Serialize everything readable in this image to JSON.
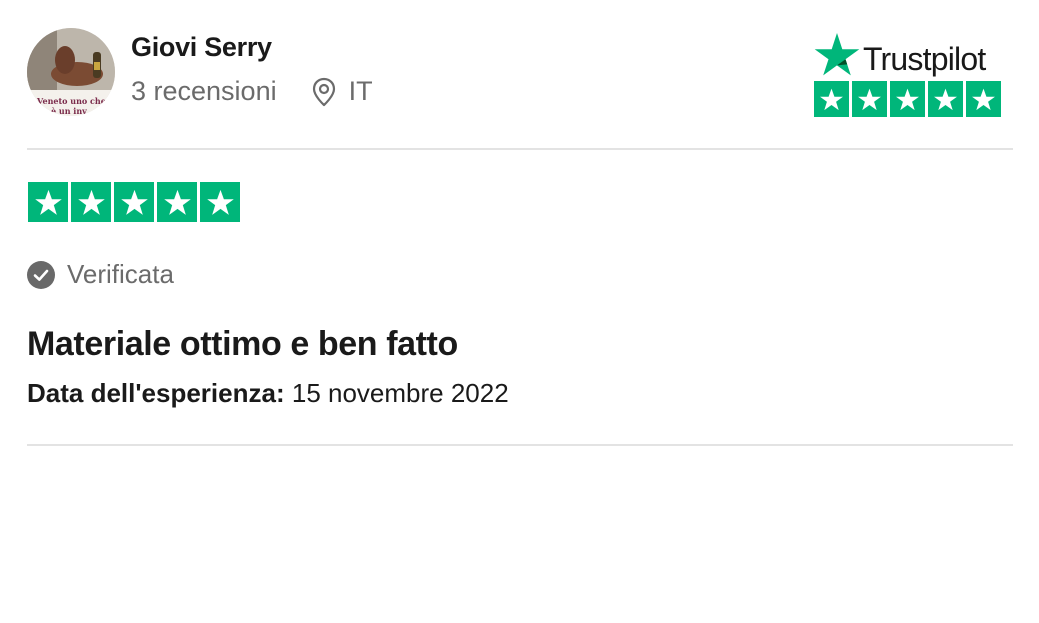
{
  "reviewer": {
    "name": "Giovi Serry",
    "reviews_count": "3 recensioni",
    "country": "IT",
    "avatar_caption_line1": "Veneto uno che n",
    "avatar_caption_line2": "è un inv"
  },
  "brand": {
    "name": "Trustpilot",
    "rating": 5,
    "max_rating": 5,
    "color": "#00b67a"
  },
  "review": {
    "rating": 5,
    "max_rating": 5,
    "verified_label": "Verificata",
    "title": "Materiale ottimo e ben fatto",
    "date_label": "Data dell'esperienza:",
    "date_value": "15 novembre 2022"
  },
  "icons": {
    "location": "map-pin-icon",
    "verified": "check-circle-icon",
    "star": "star-icon"
  }
}
